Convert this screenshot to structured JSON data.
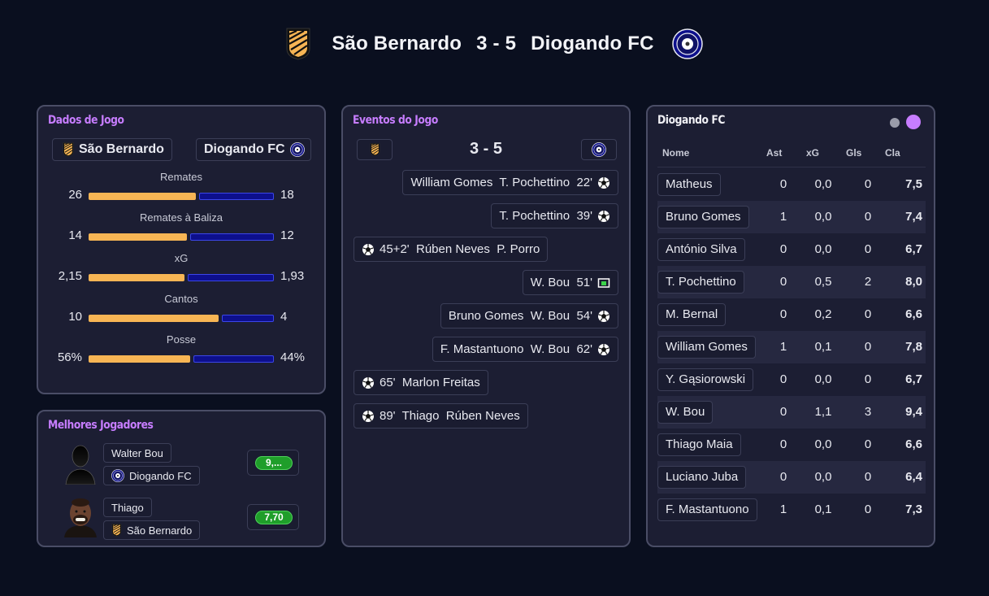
{
  "header": {
    "home_team": "São Bernardo",
    "score": "3 - 5",
    "away_team": "Diogando FC"
  },
  "colors": {
    "home": "#f7b554",
    "away": "#0d0f8c",
    "accent": "#c77dff",
    "rating_good": "#1f9e2a"
  },
  "match_data": {
    "title": "Dados de Jogo",
    "home_label": "São Bernardo",
    "away_label": "Diogando FC",
    "stats": [
      {
        "label": "Remates",
        "home": "26",
        "away": "18",
        "home_value": 26,
        "away_value": 18
      },
      {
        "label": "Remates à Baliza",
        "home": "14",
        "away": "12",
        "home_value": 14,
        "away_value": 12
      },
      {
        "label": "xG",
        "home": "2,15",
        "away": "1,93",
        "home_value": 2.15,
        "away_value": 1.93
      },
      {
        "label": "Cantos",
        "home": "10",
        "away": "4",
        "home_value": 10,
        "away_value": 4
      },
      {
        "label": "Posse",
        "home": "56%",
        "away": "44%",
        "home_value": 56,
        "away_value": 44
      }
    ]
  },
  "best_players": {
    "title": "Melhores Jogadores",
    "players": [
      {
        "name": "Walter Bou",
        "team": "Diogando FC",
        "rating": "9,..."
      },
      {
        "name": "Thiago",
        "team": "São Bernardo",
        "rating": "7,70"
      }
    ]
  },
  "events": {
    "title": "Eventos do Jogo",
    "score": "3 - 5",
    "items": [
      {
        "text": "William Gomes  T. Pochettino  22'",
        "side": "away",
        "icon": "soccer-ball-icon"
      },
      {
        "text": "T. Pochettino  39'",
        "side": "away",
        "icon": "soccer-ball-icon"
      },
      {
        "text": "45+2'  Rúben Neves  P. Porro",
        "side": "home",
        "icon": "soccer-ball-icon"
      },
      {
        "text": "W. Bou  51'",
        "side": "away",
        "icon": "penalty-goal-icon"
      },
      {
        "text": "Bruno Gomes  W. Bou  54'",
        "side": "away",
        "icon": "soccer-ball-icon"
      },
      {
        "text": "F. Mastantuono  W. Bou  62'",
        "side": "away",
        "icon": "soccer-ball-icon"
      },
      {
        "text": "65'  Marlon Freitas",
        "side": "home",
        "icon": "soccer-ball-icon"
      },
      {
        "text": "89'  Thiago  Rúben Neves",
        "side": "home",
        "icon": "soccer-ball-icon"
      }
    ]
  },
  "lineup": {
    "title": "Diogando FC",
    "columns": [
      "Nome",
      "Ast",
      "xG",
      "Gls",
      "Cla"
    ],
    "rows": [
      {
        "name": "Matheus",
        "ast": "0",
        "xg": "0,0",
        "gls": "0",
        "cla": "7,5"
      },
      {
        "name": "Bruno Gomes",
        "ast": "1",
        "xg": "0,0",
        "gls": "0",
        "cla": "7,4"
      },
      {
        "name": "António Silva",
        "ast": "0",
        "xg": "0,0",
        "gls": "0",
        "cla": "6,7"
      },
      {
        "name": "T. Pochettino",
        "ast": "0",
        "xg": "0,5",
        "gls": "2",
        "cla": "8,0"
      },
      {
        "name": "M. Bernal",
        "ast": "0",
        "xg": "0,2",
        "gls": "0",
        "cla": "6,6"
      },
      {
        "name": "William Gomes",
        "ast": "1",
        "xg": "0,1",
        "gls": "0",
        "cla": "7,8"
      },
      {
        "name": "Y. Gąsiorowski",
        "ast": "0",
        "xg": "0,0",
        "gls": "0",
        "cla": "6,7"
      },
      {
        "name": "W. Bou",
        "ast": "0",
        "xg": "1,1",
        "gls": "3",
        "cla": "9,4"
      },
      {
        "name": "Thiago Maia",
        "ast": "0",
        "xg": "0,0",
        "gls": "0",
        "cla": "6,6"
      },
      {
        "name": "Luciano Juba",
        "ast": "0",
        "xg": "0,0",
        "gls": "0",
        "cla": "6,4"
      },
      {
        "name": "F. Mastantuono",
        "ast": "1",
        "xg": "0,1",
        "gls": "0",
        "cla": "7,3"
      }
    ]
  }
}
